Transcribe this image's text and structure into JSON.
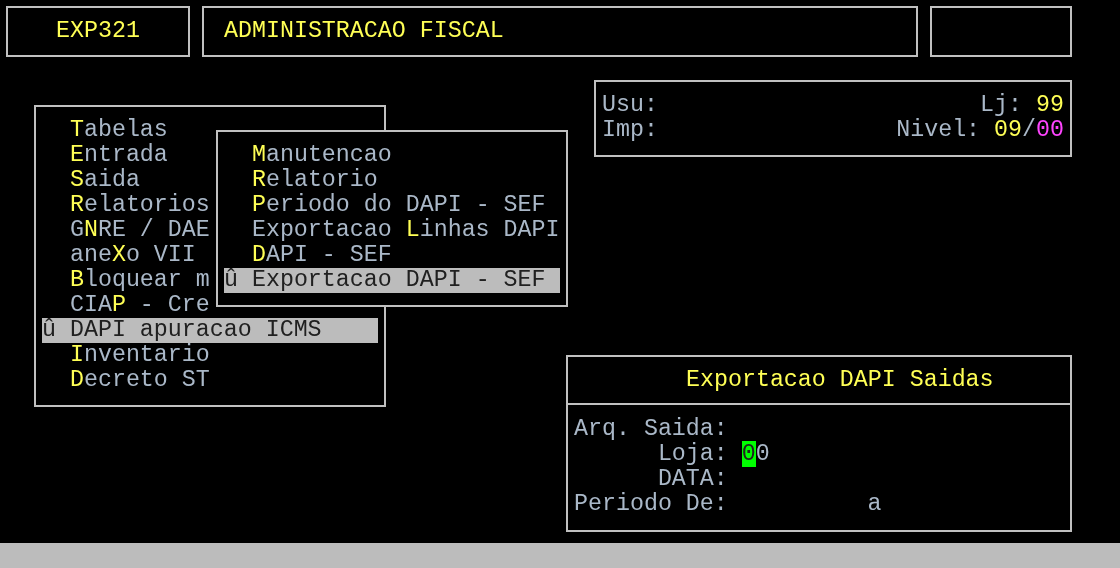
{
  "header": {
    "program": "EXP321",
    "title": "ADMINISTRACAO FISCAL"
  },
  "info": {
    "rows": [
      {
        "label": "Usu:",
        "right_label": "Lj:",
        "right_parts": [
          {
            "text": "99",
            "color": "#ffff55"
          }
        ]
      },
      {
        "label": "Imp:",
        "right_label": "Nivel:",
        "right_parts": [
          {
            "text": "09",
            "color": "#ffff55"
          },
          {
            "text": "/",
            "color": "#aab8c8"
          },
          {
            "text": "00",
            "color": "#ff44ff"
          }
        ]
      }
    ]
  },
  "main_menu": {
    "items": [
      {
        "key": "T",
        "after": "abelas",
        "selected": false
      },
      {
        "key": "E",
        "after": "ntrada",
        "selected": false
      },
      {
        "key": "S",
        "after": "aida",
        "selected": false
      },
      {
        "key": "R",
        "after": "elatorios",
        "selected": false
      },
      {
        "before": "G",
        "key": "N",
        "after": "RE / DAE",
        "selected": false
      },
      {
        "before": "ane",
        "key": "X",
        "after": "o VII",
        "selected": false
      },
      {
        "key": "B",
        "after": "loquear m",
        "selected": false
      },
      {
        "before": "CIA",
        "key": "P",
        "after": " - Cre",
        "selected": false
      },
      {
        "after": "DAPI apuracao ICMS",
        "selected": true,
        "marker": "û"
      },
      {
        "key": "I",
        "after": "nventario",
        "selected": false
      },
      {
        "key": "D",
        "after": "ecreto ST",
        "selected": false
      }
    ]
  },
  "sub_menu": {
    "items": [
      {
        "key": "M",
        "after": "anutencao",
        "selected": false
      },
      {
        "key": "R",
        "after": "elatorio",
        "selected": false
      },
      {
        "key": "P",
        "after": "eriodo do DAPI - SEF",
        "selected": false
      },
      {
        "before": "Exportacao ",
        "key": "L",
        "after": "inhas DAPI",
        "selected": false
      },
      {
        "key": "D",
        "after": "API - SEF",
        "selected": false
      },
      {
        "after": "Exportacao DAPI - SEF",
        "selected": true,
        "marker": "û"
      }
    ]
  },
  "dialog": {
    "title": "Exportacao DAPI Saidas",
    "fields": [
      {
        "label": "Arq. Saida:"
      },
      {
        "label": "Loja:",
        "value": "00",
        "cursor": true
      },
      {
        "label": "DATA:"
      },
      {
        "label": "Periodo De:",
        "to_label": "a"
      }
    ]
  }
}
